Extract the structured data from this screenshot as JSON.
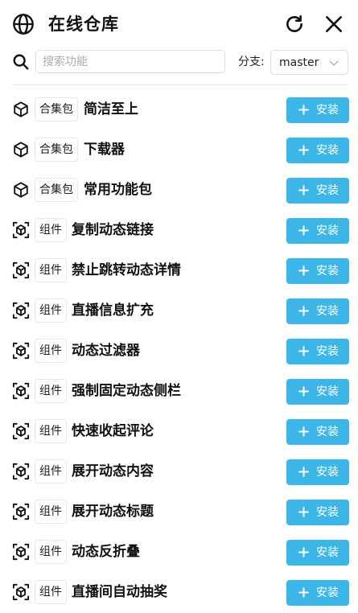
{
  "header": {
    "title": "在线仓库",
    "icon": "globe-icon",
    "actions": [
      "refresh-icon",
      "close-icon"
    ]
  },
  "search": {
    "placeholder": "搜索功能",
    "value": ""
  },
  "branch": {
    "label": "分支:",
    "selected": "master"
  },
  "colors": {
    "accent": "#3bb6e6",
    "text": "#111111",
    "border": "#dcdfe6"
  },
  "items": [
    {
      "type": "合集包",
      "icon": "package-icon",
      "name": "简洁至上",
      "action": "安装"
    },
    {
      "type": "合集包",
      "icon": "package-icon",
      "name": "下载器",
      "action": "安装"
    },
    {
      "type": "合集包",
      "icon": "package-icon",
      "name": "常用功能包",
      "action": "安装"
    },
    {
      "type": "组件",
      "icon": "component-icon",
      "name": "复制动态链接",
      "action": "安装"
    },
    {
      "type": "组件",
      "icon": "component-icon",
      "name": "禁止跳转动态详情",
      "action": "安装"
    },
    {
      "type": "组件",
      "icon": "component-icon",
      "name": "直播信息扩充",
      "action": "安装"
    },
    {
      "type": "组件",
      "icon": "component-icon",
      "name": "动态过滤器",
      "action": "安装"
    },
    {
      "type": "组件",
      "icon": "component-icon",
      "name": "强制固定动态侧栏",
      "action": "安装"
    },
    {
      "type": "组件",
      "icon": "component-icon",
      "name": "快速收起评论",
      "action": "安装"
    },
    {
      "type": "组件",
      "icon": "component-icon",
      "name": "展开动态内容",
      "action": "安装"
    },
    {
      "type": "组件",
      "icon": "component-icon",
      "name": "展开动态标题",
      "action": "安装"
    },
    {
      "type": "组件",
      "icon": "component-icon",
      "name": "动态反折叠",
      "action": "安装"
    },
    {
      "type": "组件",
      "icon": "component-icon",
      "name": "直播间自动抽奖",
      "action": "安装"
    }
  ]
}
